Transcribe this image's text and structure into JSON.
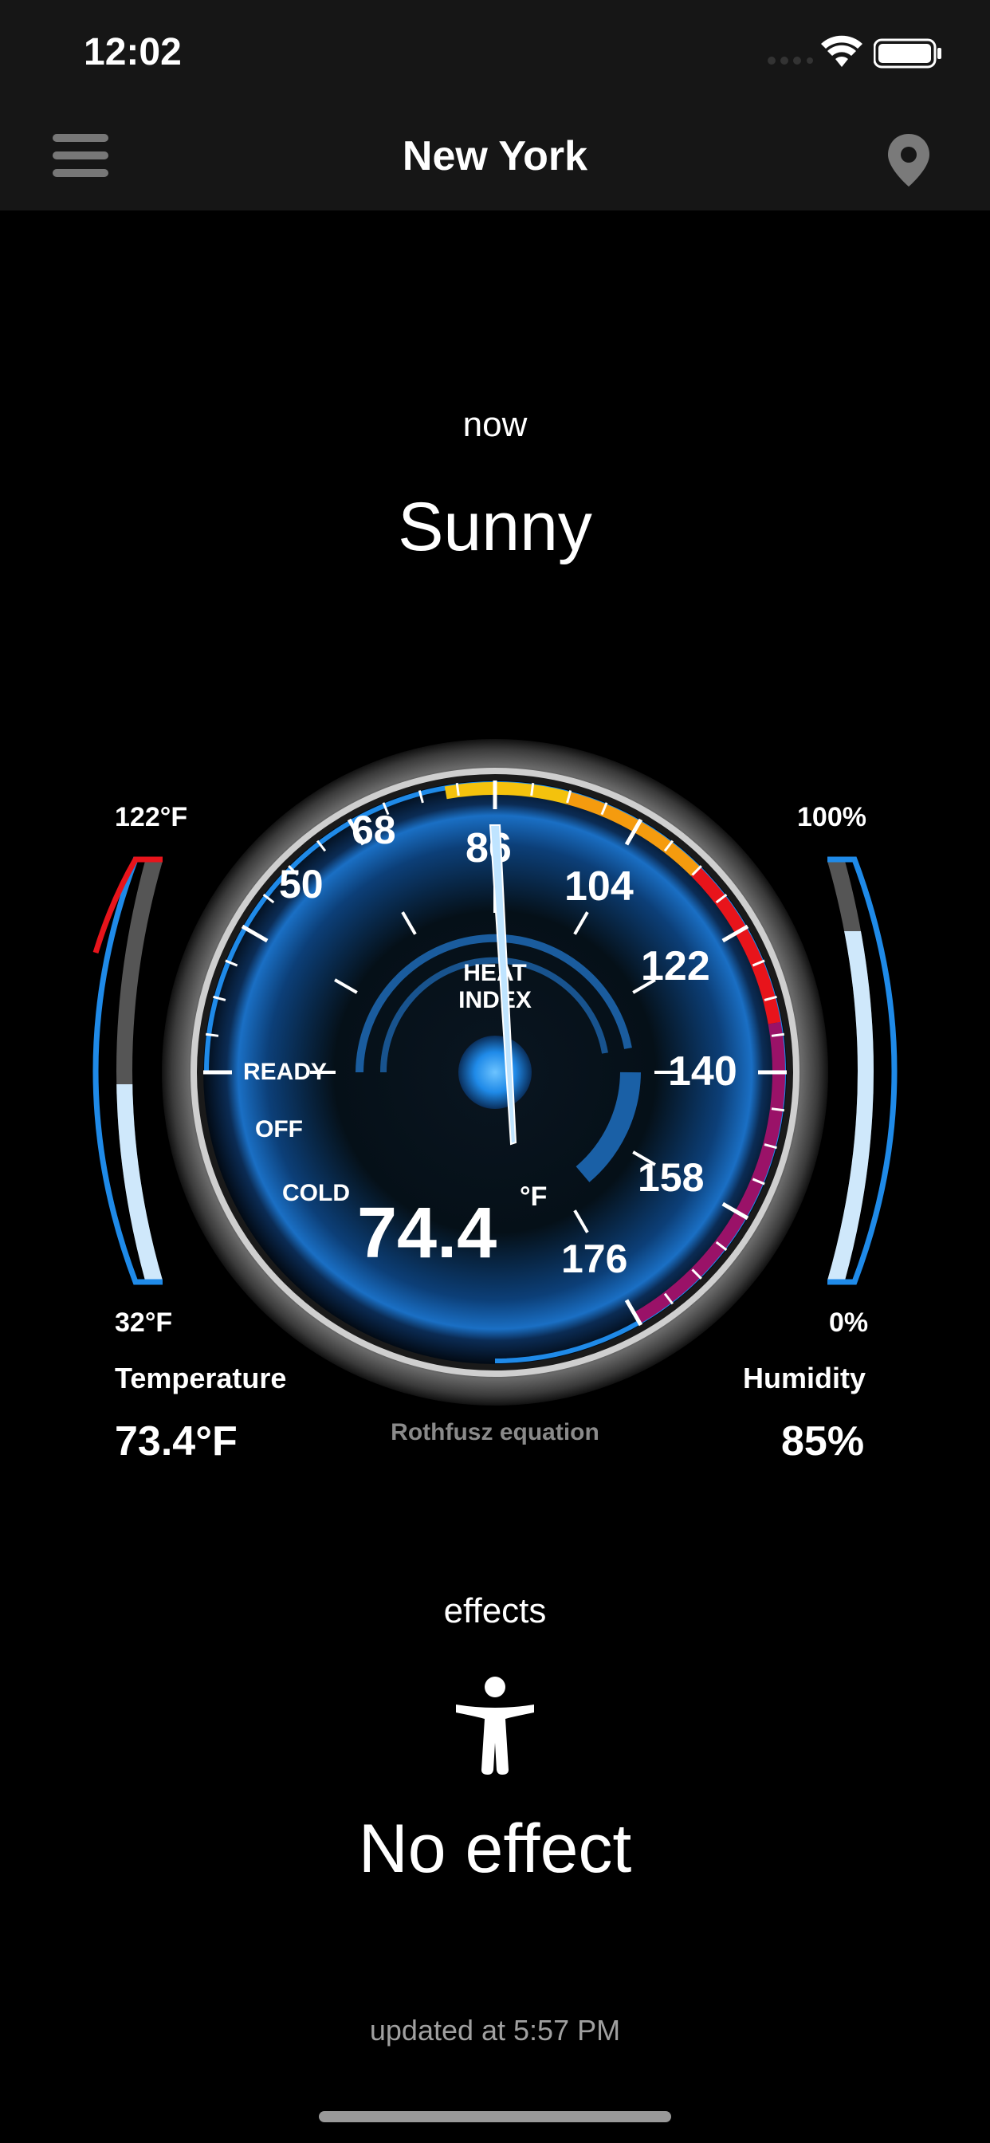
{
  "status_bar": {
    "time": "12:02"
  },
  "header": {
    "title": "New York",
    "menu_icon": "hamburger-menu-icon",
    "location_icon": "location-pin-icon"
  },
  "now": {
    "label": "now",
    "condition": "Sunny"
  },
  "gauge": {
    "scale_labels": [
      "50",
      "68",
      "86",
      "104",
      "122",
      "140",
      "158",
      "176"
    ],
    "status_labels": [
      "READY",
      "OFF",
      "COLD"
    ],
    "center_label_line1": "HEAT",
    "center_label_line2": "INDEX",
    "heat_index_value": "74.4",
    "unit": "°F",
    "equation": "Rothfusz equation",
    "needle_value": 74.4
  },
  "temperature": {
    "max_label": "122°F",
    "min_label": "32°F",
    "title": "Temperature",
    "value": "73.4°F",
    "fill_fraction": 0.46
  },
  "humidity": {
    "max_label": "100%",
    "min_label": "0%",
    "title": "Humidity",
    "value": "85%",
    "fill_fraction": 0.85
  },
  "effects": {
    "label": "effects",
    "icon": "person-icon",
    "title": "No effect"
  },
  "footer": {
    "updated": "updated at 5:57 PM"
  },
  "colors": {
    "accent_blue": "#1f8ae8",
    "light_blue": "#cfe8fb",
    "red": "#e8141b",
    "orange": "#f59b0e",
    "yellow": "#f4c20d",
    "purple": "#9a1268"
  }
}
